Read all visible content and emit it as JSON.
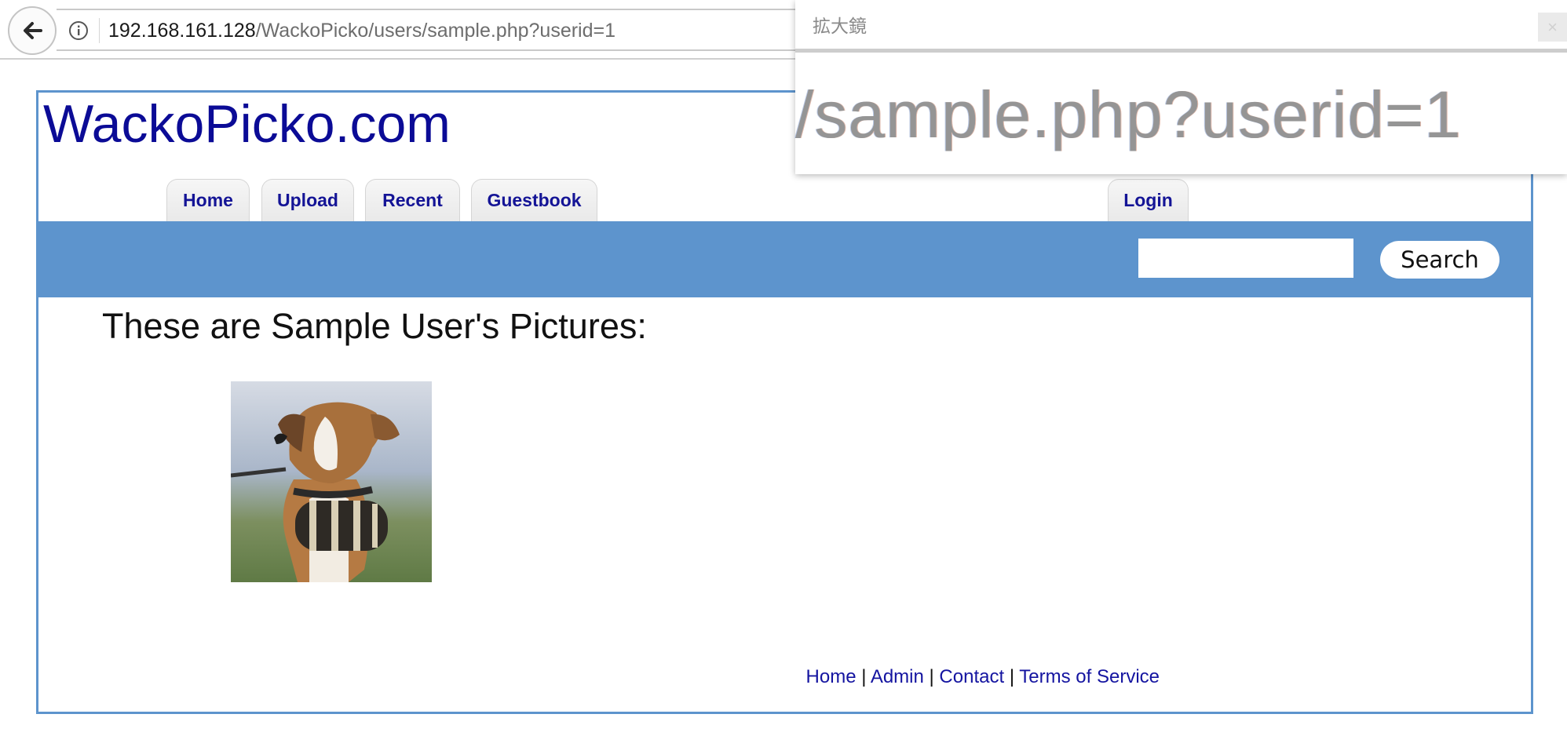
{
  "browser": {
    "url_host": "192.168.161.128",
    "url_path": "/WackoPicko/users/sample.php?userid=1"
  },
  "site": {
    "title": "WackoPicko.com"
  },
  "nav": {
    "tabs": [
      {
        "label": "Home"
      },
      {
        "label": "Upload"
      },
      {
        "label": "Recent"
      },
      {
        "label": "Guestbook"
      }
    ],
    "login_label": "Login"
  },
  "search": {
    "value": "",
    "button_label": "Search"
  },
  "main": {
    "heading": "These are Sample User's Pictures:"
  },
  "footer": {
    "links": [
      "Home",
      "Admin",
      "Contact",
      "Terms of Service"
    ],
    "separator": "|"
  },
  "magnifier": {
    "title": "拡大鏡",
    "zoomed_text": "/sample.php?userid=1",
    "close_label": "×"
  },
  "colors": {
    "accent_band": "#5d94cd",
    "link_blue": "#0b0b96"
  }
}
